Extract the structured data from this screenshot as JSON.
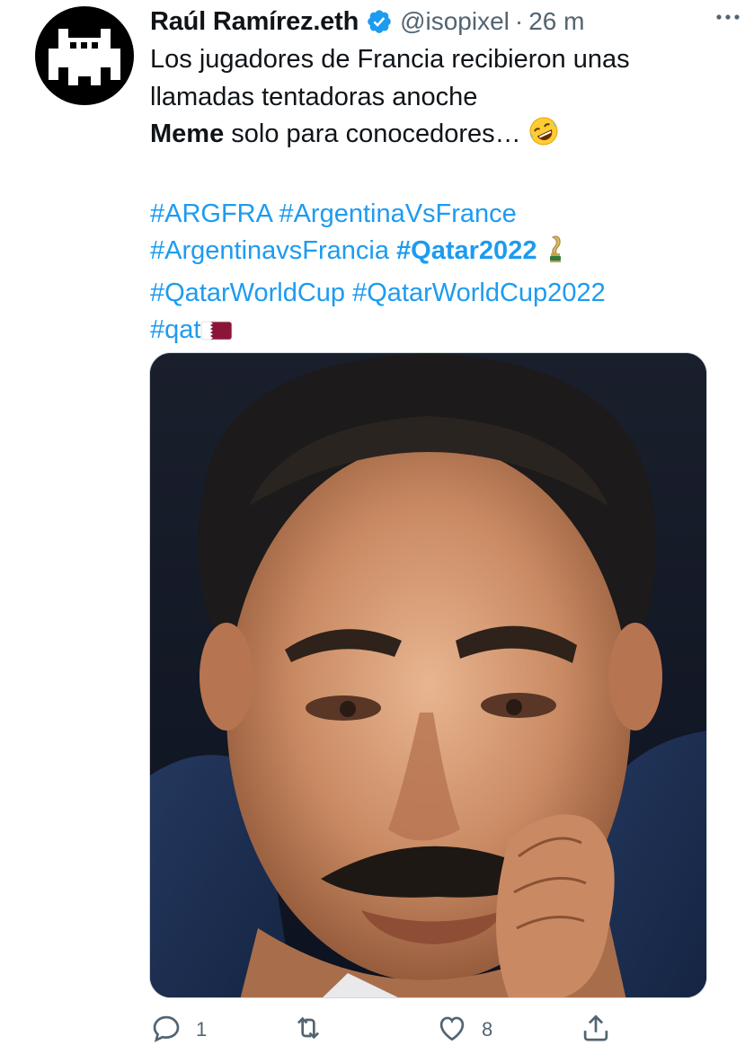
{
  "tweet": {
    "author_name": "Raúl Ramírez.eth",
    "handle": "@isopixel",
    "separator": "·",
    "time": "26 m",
    "avatar_icon": "pixel-robot-avatar",
    "verified_icon": "verified-badge-icon",
    "more_icon": "more-options-icon",
    "text_line1": "Los jugadores de Francia recibieron unas",
    "text_line2": "llamadas tentadoras anoche",
    "meme_bold": "Meme",
    "meme_rest": " solo para conocedores…",
    "hashtags": {
      "argfra": "#ARGFRA",
      "argentinavsfrance": "#ArgentinaVsFrance",
      "argentinavsfrancia": "#ArgentinavsFrancia",
      "qatar2022": "#Qatar2022",
      "qatarworldcup": "#QatarWorldCup",
      "qatarworldcup2022": "#QatarWorldCup2022",
      "qat": "#qat"
    },
    "emojis": [
      "rolling-on-floor-laughing-emoji",
      "world-cup-trophy-emoji",
      "qatar-flag-emoji"
    ],
    "media_description_icon": "meme-photo"
  },
  "actions": {
    "reply_count": "1",
    "retweet_count": "",
    "like_count": "8",
    "icons": [
      "reply-icon",
      "retweet-icon",
      "like-icon",
      "share-icon"
    ]
  },
  "colors": {
    "link": "#1d9bf0",
    "verified": "#1d9bf0",
    "secondary_text": "#536471",
    "qatar_maroon": "#8a1538"
  }
}
